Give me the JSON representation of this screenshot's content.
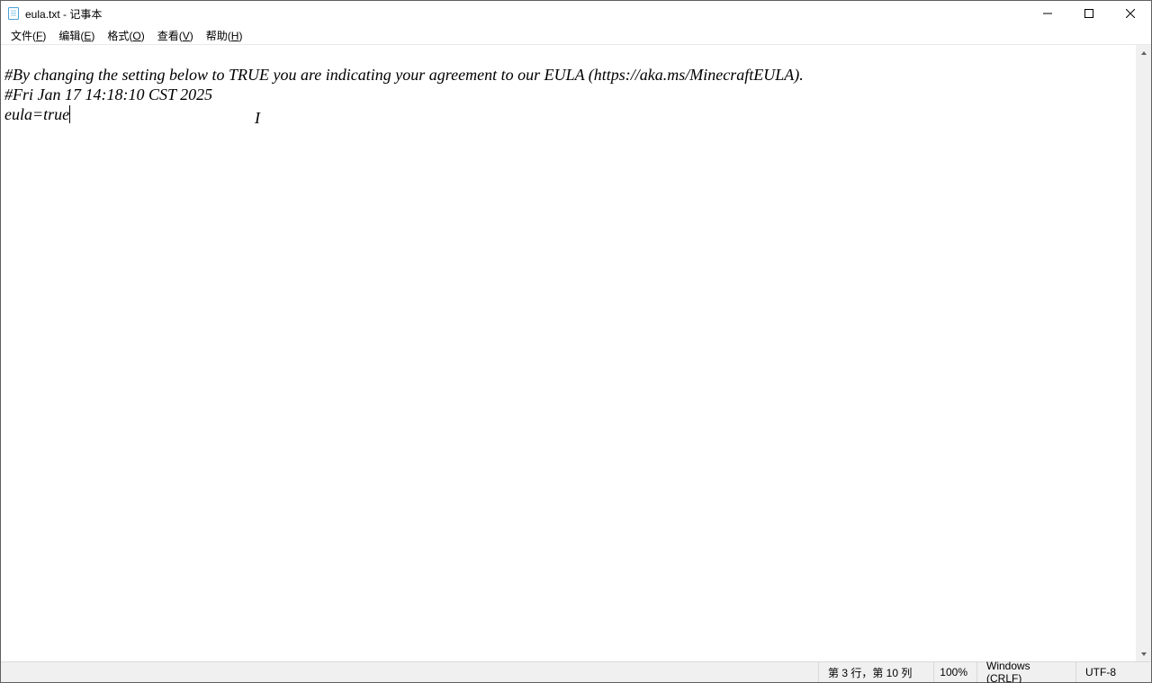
{
  "title": "eula.txt - 记事本",
  "menu": {
    "file": {
      "label": "文件",
      "accel": "F"
    },
    "edit": {
      "label": "编辑",
      "accel": "E"
    },
    "format": {
      "label": "格式",
      "accel": "O"
    },
    "view": {
      "label": "查看",
      "accel": "V"
    },
    "help": {
      "label": "帮助",
      "accel": "H"
    }
  },
  "content": {
    "line1": "#By changing the setting below to TRUE you are indicating your agreement to our EULA (https://aka.ms/MinecraftEULA).",
    "line2": "#Fri Jan 17 14:18:10 CST 2025",
    "line3": "eula=true"
  },
  "status": {
    "position": "第 3 行，第 10 列",
    "zoom": "100%",
    "line_ending": "Windows (CRLF)",
    "encoding": "UTF-8"
  }
}
